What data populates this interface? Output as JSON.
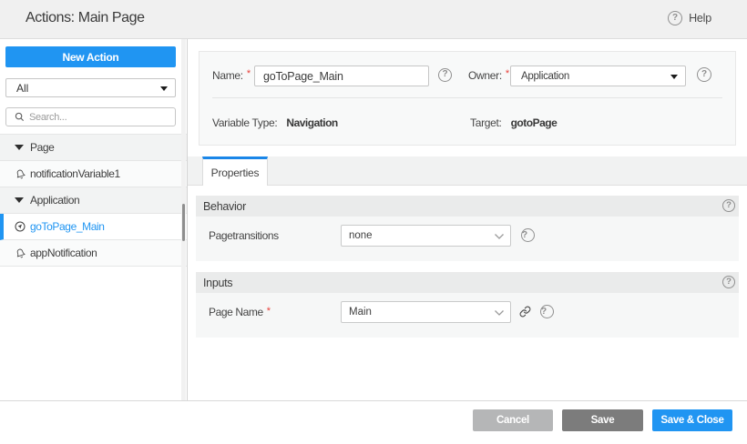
{
  "header": {
    "title": "Actions: Main Page",
    "help_label": "Help"
  },
  "sidebar": {
    "new_action_label": "New Action",
    "filter_value": "All",
    "search_placeholder": "Search...",
    "tree": [
      {
        "type": "group",
        "label": "Page"
      },
      {
        "type": "item",
        "icon": "notification-icon",
        "label": "notificationVariable1"
      },
      {
        "type": "group",
        "label": "Application"
      },
      {
        "type": "item",
        "icon": "navigation-icon",
        "label": "goToPage_Main",
        "selected": true
      },
      {
        "type": "item",
        "icon": "notification-icon",
        "label": "appNotification"
      }
    ]
  },
  "form": {
    "name": {
      "label": "Name:",
      "required": "*",
      "value": "goToPage_Main"
    },
    "owner": {
      "label": "Owner:",
      "required": "*",
      "value": "Application"
    },
    "variable_type": {
      "label": "Variable Type:",
      "value": "Navigation"
    },
    "target": {
      "label": "Target:",
      "value": "gotoPage"
    }
  },
  "tabs": [
    {
      "label": "Properties",
      "active": true
    }
  ],
  "sections": [
    {
      "title": "Behavior",
      "rows": [
        {
          "label": "Pagetransitions",
          "value": "none"
        }
      ]
    },
    {
      "title": "Inputs",
      "rows": [
        {
          "label": "Page Name",
          "required": "*",
          "value": "Main"
        }
      ]
    }
  ],
  "footer": {
    "buttons": [
      {
        "label": "Cancel",
        "style": "disabled-gray"
      },
      {
        "label": "Save",
        "style": "gray"
      },
      {
        "label": "Save & Close",
        "style": "primary"
      }
    ]
  },
  "colors": {
    "accent_blue": "#2095f2",
    "tab_blue": "#1a86e8",
    "required_red": "#e8403a"
  }
}
